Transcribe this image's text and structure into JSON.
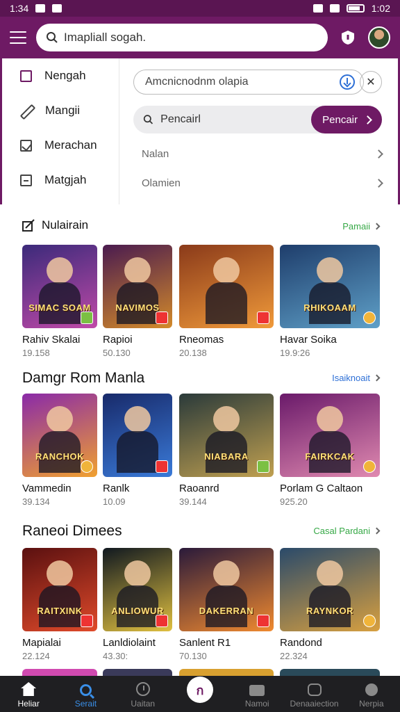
{
  "status_bar": {
    "time": "1:34",
    "right_time": "1:02"
  },
  "app_bar": {
    "search_value": "Imapliall sogah."
  },
  "side_menu": {
    "items": [
      {
        "label": "Nengah"
      },
      {
        "label": "Mangii"
      },
      {
        "label": "Merachan"
      },
      {
        "label": "Matgjah"
      }
    ]
  },
  "search_panel": {
    "field_value": "Amcnicnodnm olapia",
    "search_value": "Pencairl",
    "search_button": "Pencair",
    "links": [
      {
        "label": "Nalan"
      },
      {
        "label": "Olamien"
      }
    ]
  },
  "sections": [
    {
      "title": "Nulairain",
      "link": "Pamaii",
      "link_color": "#36a846",
      "cards": [
        {
          "caption": "SIMAC SOAM",
          "name": "Rahiv Skalai",
          "meta": "19.158",
          "colors": [
            "#3b2a7a",
            "#c04aa8"
          ],
          "badge": "green"
        },
        {
          "caption": "NAVIMOS",
          "name": "Rapioi",
          "meta": "50.130",
          "colors": [
            "#4a1b4f",
            "#d38a2a"
          ],
          "badge": "red"
        },
        {
          "caption": "",
          "name": "Rneomas",
          "meta": "20.138",
          "colors": [
            "#8a3a1a",
            "#f09a3a"
          ],
          "badge": "red"
        },
        {
          "caption": "RHIKOAAM",
          "name": "Havar Soika",
          "meta": "19.9:26",
          "colors": [
            "#1e3d6b",
            "#5fa0c8"
          ],
          "badge": "gold"
        }
      ]
    },
    {
      "title": "Damgr Rom Manla",
      "link": "Isaiknoait",
      "link_color": "#2d6fd6",
      "cards": [
        {
          "caption": "RANCHOK",
          "name": "Vammedin",
          "meta": "39.134",
          "colors": [
            "#8a2aa8",
            "#f0a030"
          ],
          "badge": "gold"
        },
        {
          "caption": "",
          "name": "Ranlk",
          "meta": "10.09",
          "colors": [
            "#182a6a",
            "#3a7ad8"
          ],
          "badge": "red"
        },
        {
          "caption": "NIABARA",
          "name": "Raoanrd",
          "meta": "39.144",
          "colors": [
            "#2a3a3a",
            "#c0a050"
          ],
          "badge": "green"
        },
        {
          "caption": "FAIRKCAK",
          "name": "Porlam G Caltaon",
          "meta": "925.20",
          "colors": [
            "#6a1a6a",
            "#e08ab0"
          ],
          "badge": "gold"
        }
      ]
    },
    {
      "title": "Raneoi Dimees",
      "link": "Casal Pardani",
      "link_color": "#36a846",
      "cards": [
        {
          "caption": "RAITXINK",
          "name": "Mapialai",
          "meta": "22.124",
          "colors": [
            "#5a1010",
            "#e04a2a"
          ],
          "badge": "red"
        },
        {
          "caption": "ANLIOWUR",
          "name": "Lanldiolaint",
          "meta": "43.30:",
          "colors": [
            "#101820",
            "#e0c040"
          ],
          "badge": "red"
        },
        {
          "caption": "DAKERRAN",
          "name": "Sanlent R1",
          "meta": "70.130",
          "colors": [
            "#2a1a3a",
            "#f08a30"
          ],
          "badge": "red"
        },
        {
          "caption": "RAYNKOR",
          "name": "Randond",
          "meta": "22.324",
          "colors": [
            "#2a4a6a",
            "#d8a040"
          ],
          "badge": "gold"
        }
      ]
    }
  ],
  "bottom_nav": [
    {
      "label": "Heliar"
    },
    {
      "label": "Serait"
    },
    {
      "label": "Uaitan"
    },
    {
      "label": ""
    },
    {
      "label": "Namoi"
    },
    {
      "label": "Denaaiection"
    },
    {
      "label": "Nerpia"
    }
  ],
  "accent": "#6e1a64"
}
